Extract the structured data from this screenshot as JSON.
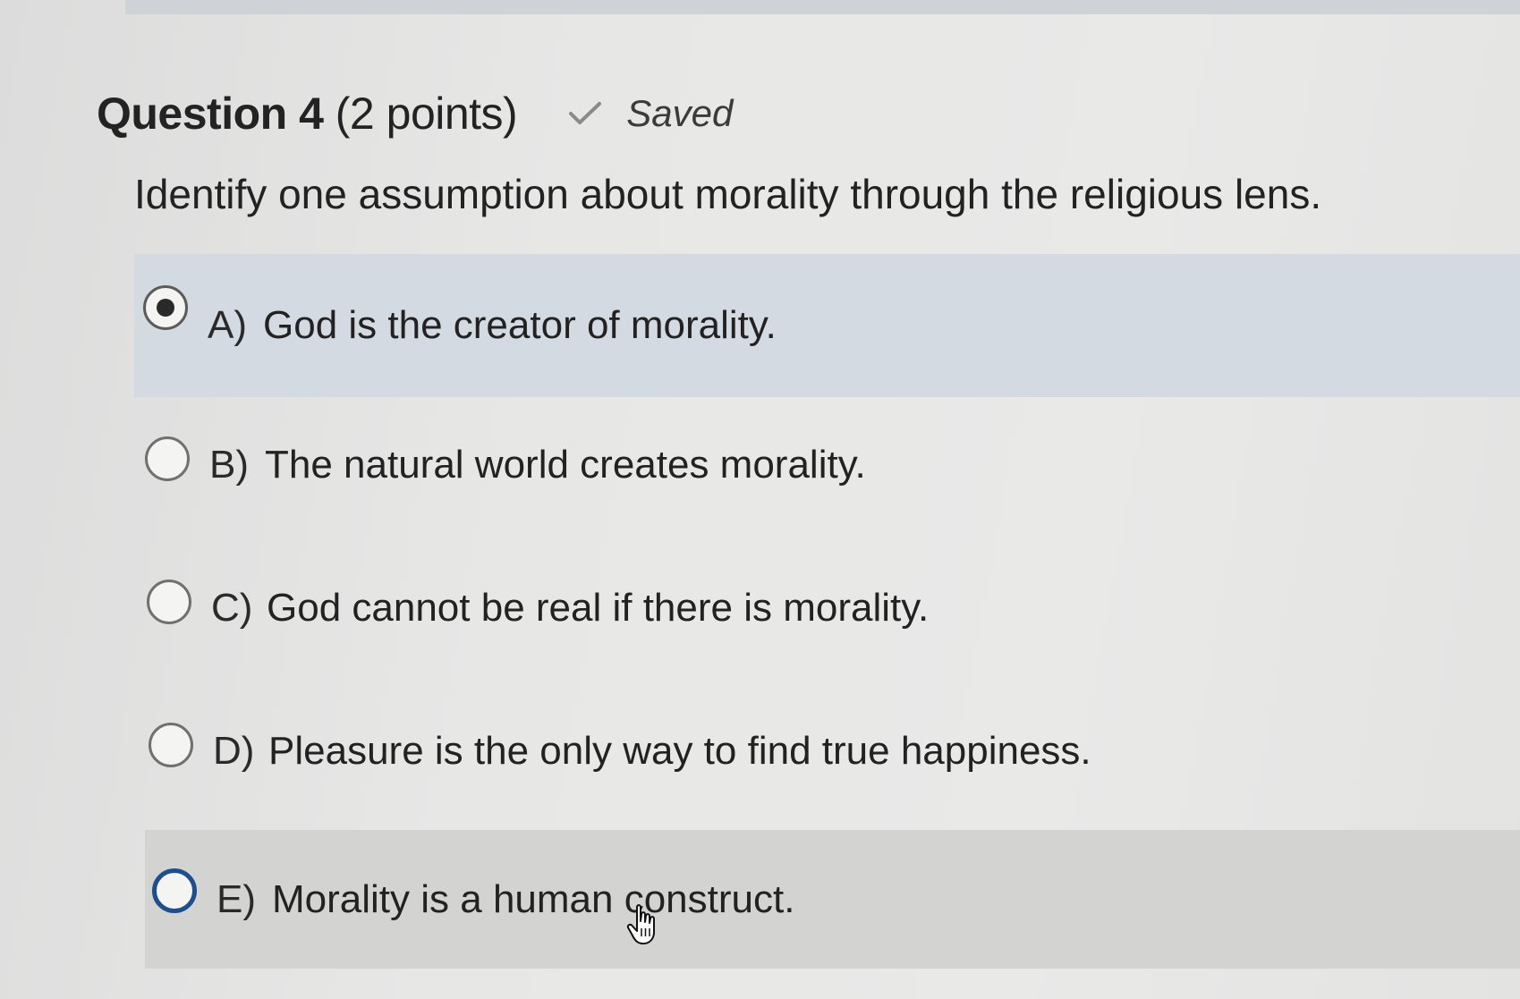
{
  "question": {
    "title": "Question 4",
    "points": "(2 points)",
    "status": "Saved",
    "prompt": "Identify one assumption about morality through the religious lens."
  },
  "options": [
    {
      "letter": "A)",
      "text": "God is the creator of morality.",
      "selected": true
    },
    {
      "letter": "B)",
      "text": "The natural world creates morality.",
      "selected": false
    },
    {
      "letter": "C)",
      "text": "God cannot be real if there is morality.",
      "selected": false
    },
    {
      "letter": "D)",
      "text": "Pleasure is the only way to find true happiness.",
      "selected": false
    },
    {
      "letter": "E)",
      "text": "Morality is a human construct.",
      "selected": false
    }
  ],
  "icons": {
    "status": "checkmark-icon",
    "pointer": "hand-cursor-icon"
  },
  "colors": {
    "selected_row": "#d4dae1",
    "hover_row": "#d3d3d2",
    "focus_ring": "#1e4f8c"
  }
}
